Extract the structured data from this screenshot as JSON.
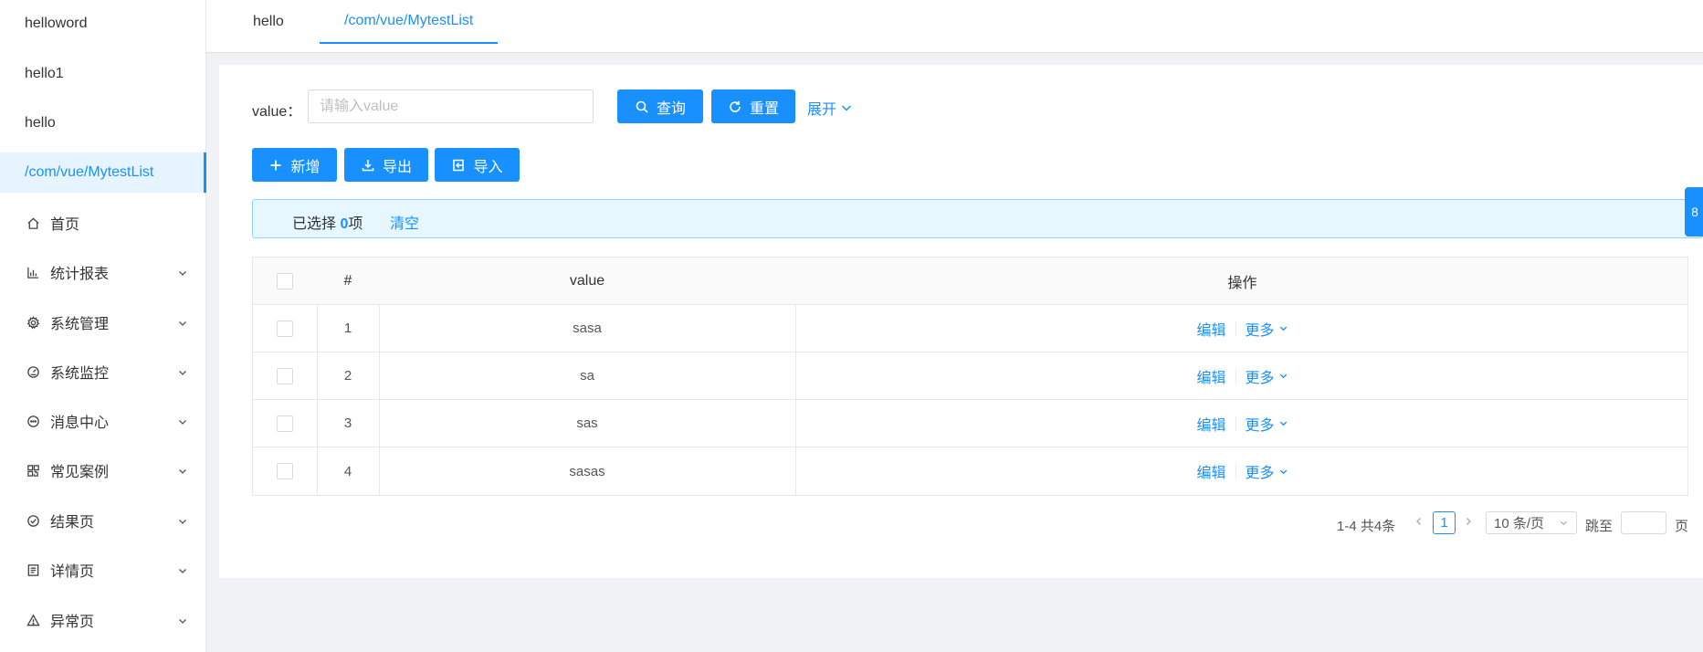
{
  "sidebar": {
    "items": [
      {
        "label": "helloword",
        "icon": null,
        "active": false,
        "expandable": false
      },
      {
        "label": "hello1",
        "icon": null,
        "active": false,
        "expandable": false
      },
      {
        "label": "hello",
        "icon": null,
        "active": false,
        "expandable": false
      },
      {
        "label": "/com/vue/MytestList",
        "icon": null,
        "active": true,
        "expandable": false
      },
      {
        "label": "首页",
        "icon": "home-icon",
        "active": false,
        "expandable": false
      },
      {
        "label": "统计报表",
        "icon": "bar-chart-icon",
        "active": false,
        "expandable": true
      },
      {
        "label": "系统管理",
        "icon": "gear-icon",
        "active": false,
        "expandable": true
      },
      {
        "label": "系统监控",
        "icon": "dashboard-icon",
        "active": false,
        "expandable": true
      },
      {
        "label": "消息中心",
        "icon": "message-icon",
        "active": false,
        "expandable": true
      },
      {
        "label": "常见案例",
        "icon": "qrcode-icon",
        "active": false,
        "expandable": true
      },
      {
        "label": "结果页",
        "icon": "check-circle-icon",
        "active": false,
        "expandable": true
      },
      {
        "label": "详情页",
        "icon": "profile-icon",
        "active": false,
        "expandable": true
      },
      {
        "label": "异常页",
        "icon": "warning-icon",
        "active": false,
        "expandable": true
      }
    ]
  },
  "tabs": [
    {
      "label": "hello",
      "active": false
    },
    {
      "label": "/com/vue/MytestList",
      "active": true
    }
  ],
  "search": {
    "label": "value：",
    "placeholder": "请输入value",
    "value": "",
    "query_label": "查询",
    "reset_label": "重置",
    "expand_label": "展开"
  },
  "toolbar": {
    "add_label": "新增",
    "export_label": "导出",
    "import_label": "导入"
  },
  "selection": {
    "prefix": "已选择 ",
    "count": "0",
    "suffix": "项",
    "clear_label": "清空"
  },
  "table": {
    "columns": [
      "#",
      "value",
      "操作"
    ],
    "rows": [
      {
        "index": "1",
        "value": "sasa"
      },
      {
        "index": "2",
        "value": "sa"
      },
      {
        "index": "3",
        "value": "sas"
      },
      {
        "index": "4",
        "value": "sasas"
      }
    ],
    "edit_label": "编辑",
    "more_label": "更多"
  },
  "pagination": {
    "total_text": "1-4 共4条",
    "current_page": "1",
    "page_size": "10 条/页",
    "jump_label": "跳至",
    "page_suffix": "页"
  },
  "float_button": {
    "label": "8"
  },
  "colors": {
    "accent": "#1890ff",
    "alert_bg": "#e6f7ff",
    "alert_border": "#91d5ff"
  }
}
